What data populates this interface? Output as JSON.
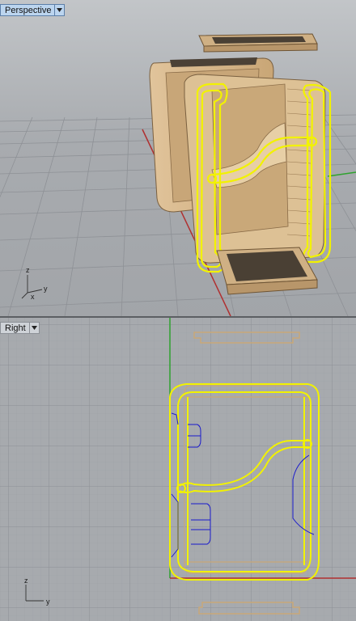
{
  "viewports": {
    "perspective": {
      "title": "Perspective",
      "axis_labels": {
        "z": "z",
        "y": "y",
        "x": "x"
      }
    },
    "right": {
      "title": "Right",
      "axis_labels": {
        "z": "z",
        "y": "y"
      }
    }
  },
  "colors": {
    "viewport_bg_top": "#9b9ea2",
    "viewport_bg_bottom": "#a7aaae",
    "grid_line": "#8b8f94",
    "grid_minor": "#9a9ea3",
    "x_axis": "#b03030",
    "y_axis": "#2fa22f",
    "selection": "#f2f200",
    "curve": "#1818c8",
    "model_fill": "#d7b98f",
    "model_edge": "#7a6040",
    "active_tab_bg": "#bcd5ef"
  },
  "icons": {
    "viewport_menu": "triangle-down-icon"
  }
}
